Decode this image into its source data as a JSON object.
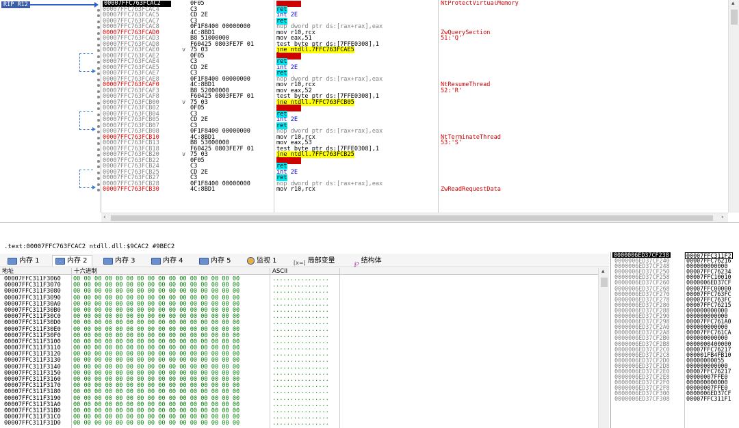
{
  "cpu": {
    "rip_label": "RIP R12",
    "rows": [
      {
        "addr": "00007FFC763FCAC2",
        "bytes": "0F05",
        "mn": "syscall",
        "kind": "syscall",
        "comment": "NtProtectVirtualMemory",
        "cur": true
      },
      {
        "addr": "00007FFC763FCAC4",
        "bytes": "C3",
        "mn": "ret",
        "kind": "ret",
        "comment": ""
      },
      {
        "addr": "00007FFC763FCAC5",
        "bytes": "CD 2E",
        "mn": "int 2E",
        "kind": "int",
        "comment": ""
      },
      {
        "addr": "00007FFC763FCAC7",
        "bytes": "C3",
        "mn": "ret",
        "kind": "ret",
        "comment": ""
      },
      {
        "addr": "00007FFC763FCAC8",
        "bytes": "0F1F8400 00000000",
        "mn": "nop dword ptr ds:[rax+rax],eax",
        "kind": "nop",
        "comment": ""
      },
      {
        "addr": "00007FFC763FCAD0",
        "bytes": "4C:8BD1",
        "mn": "mov r10,rcx",
        "kind": "plain",
        "comment": "ZwQuerySection",
        "red": true
      },
      {
        "addr": "00007FFC763FCAD3",
        "bytes": "B8 51000000",
        "mn": "mov eax,51",
        "kind": "plain",
        "comment": "51:'Q'"
      },
      {
        "addr": "00007FFC763FCAD8",
        "bytes": "F60425 0803FE7F 01",
        "mn": "test byte ptr ds:[7FFE0308],1",
        "kind": "test",
        "comment": ""
      },
      {
        "addr": "00007FFC763FCAE0",
        "bytes": "75 03",
        "mn": "jne ntdll.7FFC763FCAE5",
        "kind": "jne",
        "comment": "",
        "tog": "v"
      },
      {
        "addr": "00007FFC763FCAE2",
        "bytes": "0F05",
        "mn": "syscall",
        "kind": "syscall",
        "comment": ""
      },
      {
        "addr": "00007FFC763FCAE4",
        "bytes": "C3",
        "mn": "ret",
        "kind": "ret",
        "comment": ""
      },
      {
        "addr": "00007FFC763FCAE5",
        "bytes": "CD 2E",
        "mn": "int 2E",
        "kind": "int",
        "comment": ""
      },
      {
        "addr": "00007FFC763FCAE7",
        "bytes": "C3",
        "mn": "ret",
        "kind": "ret",
        "comment": ""
      },
      {
        "addr": "00007FFC763FCAE8",
        "bytes": "0F1F8400 00000000",
        "mn": "nop dword ptr ds:[rax+rax],eax",
        "kind": "nop",
        "comment": ""
      },
      {
        "addr": "00007FFC763FCAF0",
        "bytes": "4C:8BD1",
        "mn": "mov r10,rcx",
        "kind": "plain",
        "comment": "NtResumeThread",
        "red": true
      },
      {
        "addr": "00007FFC763FCAF3",
        "bytes": "B8 52000000",
        "mn": "mov eax,52",
        "kind": "plain",
        "comment": "52:'R'"
      },
      {
        "addr": "00007FFC763FCAF8",
        "bytes": "F60425 0803FE7F 01",
        "mn": "test byte ptr ds:[7FFE0308],1",
        "kind": "test",
        "comment": ""
      },
      {
        "addr": "00007FFC763FCB00",
        "bytes": "75 03",
        "mn": "jne ntdll.7FFC763FCB05",
        "kind": "jne",
        "comment": "",
        "tog": "v"
      },
      {
        "addr": "00007FFC763FCB02",
        "bytes": "0F05",
        "mn": "syscall",
        "kind": "syscall",
        "comment": ""
      },
      {
        "addr": "00007FFC763FCB04",
        "bytes": "C3",
        "mn": "ret",
        "kind": "ret",
        "comment": ""
      },
      {
        "addr": "00007FFC763FCB05",
        "bytes": "CD 2E",
        "mn": "int 2E",
        "kind": "int",
        "comment": ""
      },
      {
        "addr": "00007FFC763FCB07",
        "bytes": "C3",
        "mn": "ret",
        "kind": "ret",
        "comment": ""
      },
      {
        "addr": "00007FFC763FCB08",
        "bytes": "0F1F8400 00000000",
        "mn": "nop dword ptr ds:[rax+rax],eax",
        "kind": "nop",
        "comment": ""
      },
      {
        "addr": "00007FFC763FCB10",
        "bytes": "4C:8BD1",
        "mn": "mov r10,rcx",
        "kind": "plain",
        "comment": "NtTerminateThread",
        "red": true
      },
      {
        "addr": "00007FFC763FCB13",
        "bytes": "B8 53000000",
        "mn": "mov eax,53",
        "kind": "plain",
        "comment": "53:'S'"
      },
      {
        "addr": "00007FFC763FCB18",
        "bytes": "F60425 0803FE7F 01",
        "mn": "test byte ptr ds:[7FFE0308],1",
        "kind": "test",
        "comment": ""
      },
      {
        "addr": "00007FFC763FCB20",
        "bytes": "75 03",
        "mn": "jne ntdll.7FFC763FCB25",
        "kind": "jne",
        "comment": "",
        "tog": "v"
      },
      {
        "addr": "00007FFC763FCB22",
        "bytes": "0F05",
        "mn": "syscall",
        "kind": "syscall",
        "comment": ""
      },
      {
        "addr": "00007FFC763FCB24",
        "bytes": "C3",
        "mn": "ret",
        "kind": "ret",
        "comment": ""
      },
      {
        "addr": "00007FFC763FCB25",
        "bytes": "CD 2E",
        "mn": "int 2E",
        "kind": "int",
        "comment": ""
      },
      {
        "addr": "00007FFC763FCB27",
        "bytes": "C3",
        "mn": "ret",
        "kind": "ret",
        "comment": ""
      },
      {
        "addr": "00007FFC763FCB28",
        "bytes": "0F1F8400 00000000",
        "mn": "nop dword ptr ds:[rax+rax],eax",
        "kind": "nop",
        "comment": ""
      },
      {
        "addr": "00007FFC763FCB30",
        "bytes": "4C:8BD1",
        "mn": "mov r10,rcx",
        "kind": "plain",
        "comment": "ZwReadRequestData",
        "red": true
      }
    ]
  },
  "info_line": ".text:00007FFC763FCAC2 ntdll.dll:$9CAC2 #9BEC2",
  "tabs": [
    {
      "label": "内存 1",
      "icon": "memory-icon"
    },
    {
      "label": "内存 2",
      "icon": "memory-icon",
      "active": true
    },
    {
      "label": "内存 3",
      "icon": "memory-icon"
    },
    {
      "label": "内存 4",
      "icon": "memory-icon"
    },
    {
      "label": "内存 5",
      "icon": "memory-icon"
    },
    {
      "label": "监视 1",
      "icon": "watch-icon"
    },
    {
      "label": "局部变量",
      "icon": "locals-icon"
    },
    {
      "label": "结构体",
      "icon": "struct-icon"
    }
  ],
  "locals_icon_text": "[x=]",
  "dump": {
    "headers": {
      "address": "地址",
      "hex": "十六进制",
      "ascii": "ASCII"
    },
    "hex_value": "00 00 00 00 00 00 00 00 00 00 00 00 00 00 00 00",
    "ascii_value": "................",
    "rows": [
      "00007FFC311F3060",
      "00007FFC311F3070",
      "00007FFC311F3080",
      "00007FFC311F3090",
      "00007FFC311F30A0",
      "00007FFC311F30B0",
      "00007FFC311F30C0",
      "00007FFC311F30D0",
      "00007FFC311F30E0",
      "00007FFC311F30F0",
      "00007FFC311F3100",
      "00007FFC311F3110",
      "00007FFC311F3120",
      "00007FFC311F3130",
      "00007FFC311F3140",
      "00007FFC311F3150",
      "00007FFC311F3160",
      "00007FFC311F3170",
      "00007FFC311F3180",
      "00007FFC311F3190",
      "00007FFC311F31A0",
      "00007FFC311F31B0",
      "00007FFC311F31C0",
      "00007FFC311F31D0"
    ]
  },
  "stack": [
    {
      "addr": "0000006ED37CF238",
      "val": "00007FFC311F2",
      "cur": true
    },
    {
      "addr": "0000006ED37CF240",
      "val": "00007FFC76216"
    },
    {
      "addr": "0000006ED37CF248",
      "val": "000000000000"
    },
    {
      "addr": "0000006ED37CF250",
      "val": "00007FFC76234"
    },
    {
      "addr": "0000006ED37CF258",
      "val": "00007FFC10010"
    },
    {
      "addr": "0000006ED37CF260",
      "val": "0000006ED37CF"
    },
    {
      "addr": "0000006ED37CF268",
      "val": "00007FFC00000"
    },
    {
      "addr": "0000006ED37CF270",
      "val": "00007FFC763FC"
    },
    {
      "addr": "0000006ED37CF278",
      "val": "00007FFC763FC"
    },
    {
      "addr": "0000006ED37CF280",
      "val": "00007FFC76215"
    },
    {
      "addr": "0000006ED37CF288",
      "val": "000000000000"
    },
    {
      "addr": "0000006ED37CF290",
      "val": "000000000000"
    },
    {
      "addr": "0000006ED37CF298",
      "val": "00007FFC761A0"
    },
    {
      "addr": "0000006ED37CF2A0",
      "val": "000000000000"
    },
    {
      "addr": "0000006ED37CF2A8",
      "val": "00007FFC761CA"
    },
    {
      "addr": "0000006ED37CF2B0",
      "val": "000000000000"
    },
    {
      "addr": "0000006ED37CF2B8",
      "val": "0000000400000"
    },
    {
      "addr": "0000006ED37CF2C0",
      "val": "00007FFC76217"
    },
    {
      "addr": "0000006ED37CF2C8",
      "val": "000001FB4FB10"
    },
    {
      "addr": "0000006ED37CF2D0",
      "val": "00000000055"
    },
    {
      "addr": "0000006ED37CF2D8",
      "val": "000000000000"
    },
    {
      "addr": "0000006ED37CF2E0",
      "val": "00007FFC76217"
    },
    {
      "addr": "0000006ED37CF2E8",
      "val": "00000007FFE0"
    },
    {
      "addr": "0000006ED37CF2F0",
      "val": "000000000000"
    },
    {
      "addr": "0000006ED37CF2F8",
      "val": "00000007FFE0"
    },
    {
      "addr": "0000006ED37CF300",
      "val": "0000006ED37CF"
    },
    {
      "addr": "0000006ED37CF308",
      "val": "00007FFC311F1"
    }
  ]
}
